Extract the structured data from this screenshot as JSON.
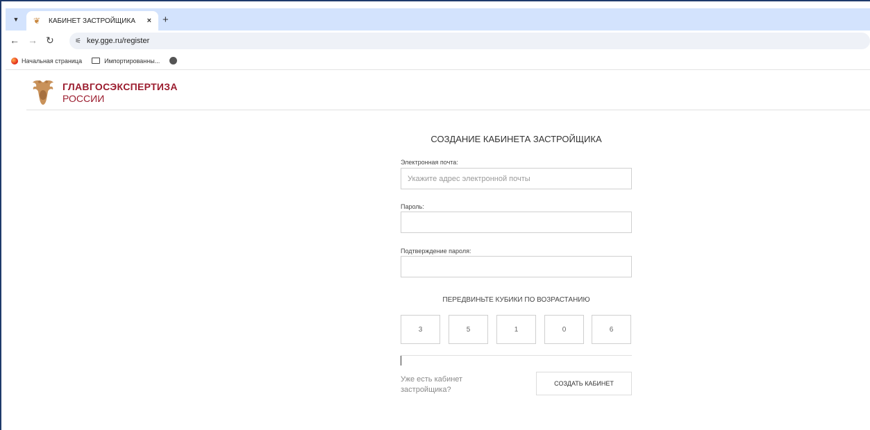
{
  "browser": {
    "tab_title": "КАБИНЕТ ЗАСТРОЙЩИКА",
    "tab_close": "×",
    "new_tab": "+",
    "url": "key.gge.ru/register",
    "bookmarks": [
      {
        "label": "Начальная страница"
      },
      {
        "label": "Импортированны..."
      }
    ]
  },
  "site": {
    "logo_title": "ГЛАВГОСЭКСПЕРТИЗА",
    "logo_subtitle": "РОССИИ"
  },
  "form": {
    "title": "СОЗДАНИЕ КАБИНЕТА ЗАСТРОЙЩИКА",
    "email_label": "Электронная почта:",
    "email_placeholder": "Укажите адрес электронной почты",
    "email_value": "",
    "password_label": "Пароль:",
    "password_value": "",
    "confirm_label": "Подтверждение пароля:",
    "confirm_value": "",
    "captcha_title": "ПЕРЕДВИНЬТЕ КУБИКИ ПО ВОЗРАСТАНИЮ",
    "cubes": [
      "3",
      "5",
      "1",
      "0",
      "6"
    ],
    "login_link": "Уже есть кабинет застройщика?",
    "submit_label": "СОЗДАТЬ КАБИНЕТ"
  }
}
